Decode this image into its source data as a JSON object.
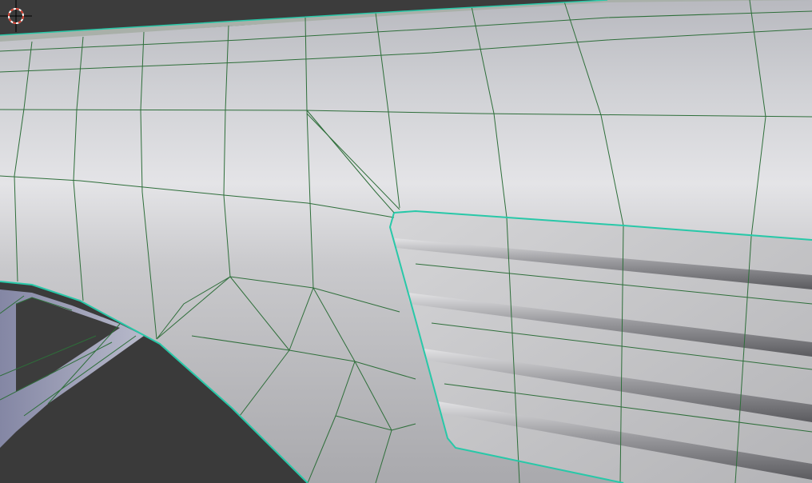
{
  "viewport": {
    "mode": "edit-mode",
    "display": "wireframe-over-solid",
    "colors": {
      "background": "#3c3c3c",
      "mesh_surface": "#c4c5c9",
      "mesh_highlight": "#e6e6e9",
      "wire": "#2e6e3a",
      "selected_edge": "#28c8a8",
      "cursor_ring": "#d03a2a"
    }
  },
  "cursor_3d": {
    "icon": "3d-cursor-icon"
  }
}
